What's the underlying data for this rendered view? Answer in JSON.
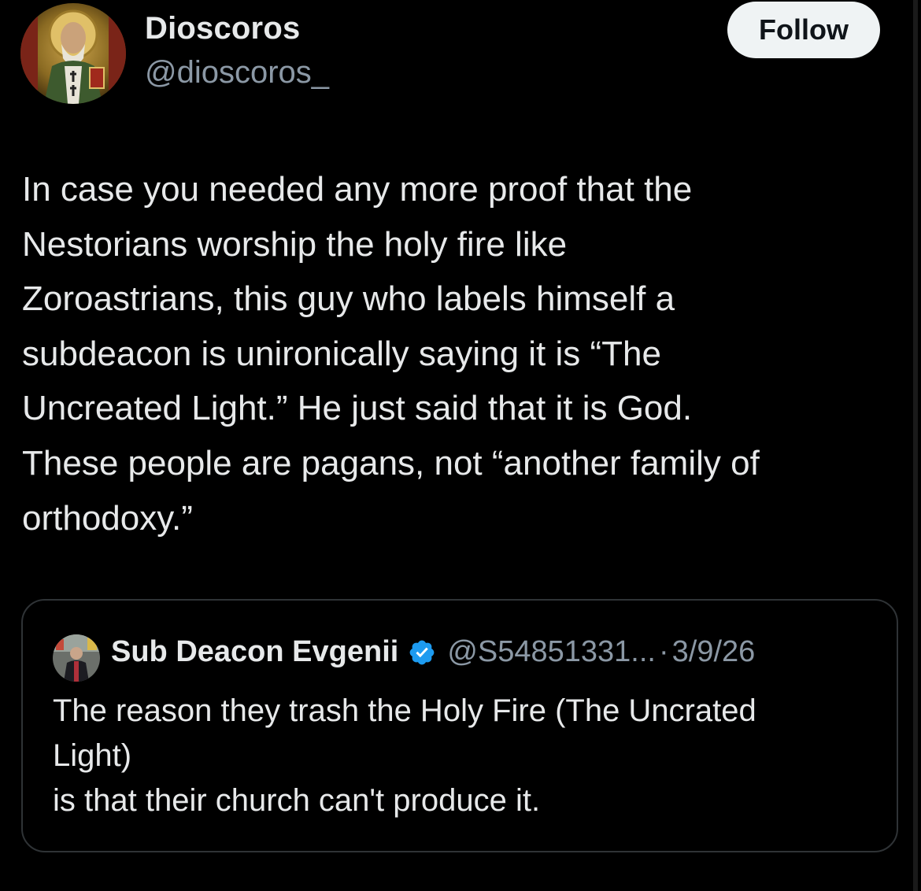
{
  "post": {
    "author": {
      "display_name": "Dioscoros",
      "handle": "@dioscoros_",
      "avatar_icon": "icon-portrait-avatar"
    },
    "follow_label": "Follow",
    "text": "In case you needed any more proof that the\nNestorians worship the holy fire like\nZoroastrians, this guy who labels himself a\nsubdeacon is unironically saying it is “The\nUncreated Light.”  He just said that it is God.\nThese people are pagans, not “another family of\northodoxy.”"
  },
  "quoted_post": {
    "author": {
      "display_name": "Sub Deacon Evgenii",
      "handle": "@S54851331...",
      "verified_icon": "verified-badge-icon",
      "avatar_icon": "photo-avatar"
    },
    "separator": "·",
    "date": "3/9/26",
    "text": "The reason they trash the Holy Fire (The Uncrated\nLight)\nis that their church can't produce it."
  },
  "colors": {
    "background": "#000000",
    "text_primary": "#e7e9ea",
    "text_secondary": "#8b98a5",
    "follow_bg": "#eff3f4",
    "border": "#2f3336",
    "verified": "#1d9bf0"
  }
}
